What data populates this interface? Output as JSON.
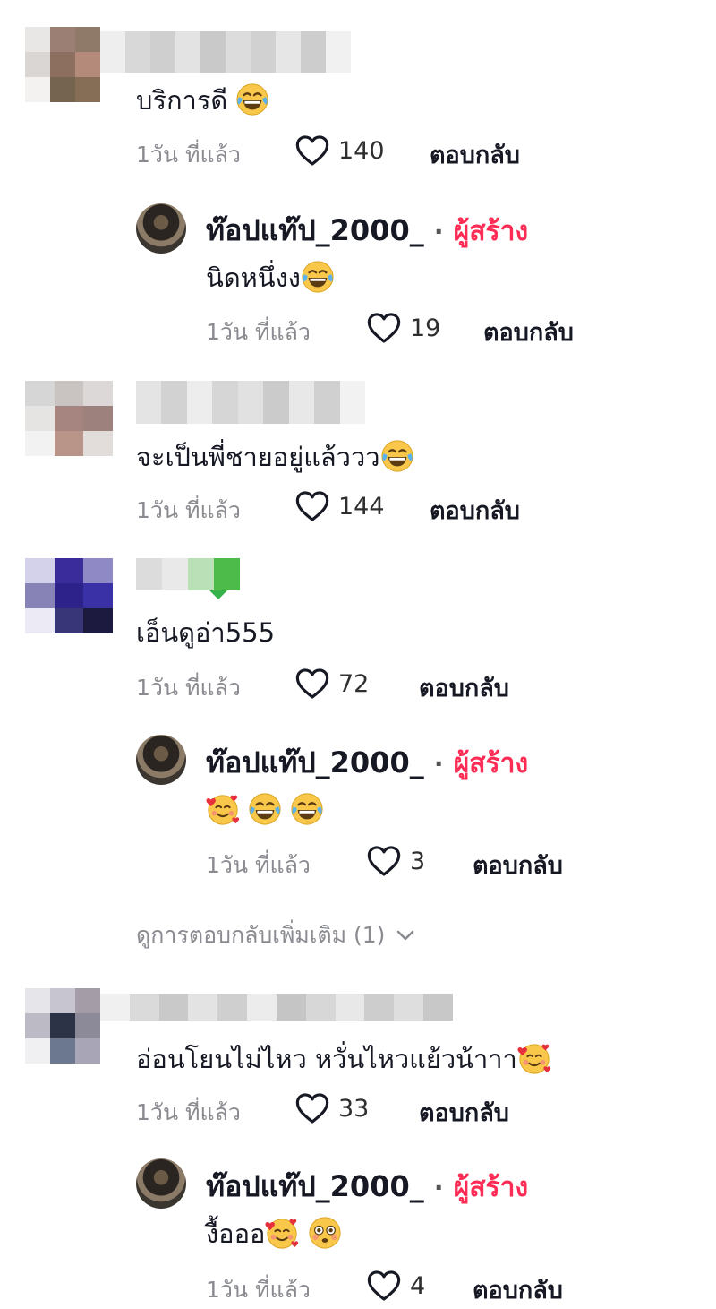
{
  "comments": [
    {
      "text": "บริการดี",
      "emojis": [
        "laugh-cry-emoji"
      ],
      "time": "1วัน ที่แล้ว",
      "likes": "140",
      "reply": "ตอบกลับ",
      "replies": [
        {
          "name": "ท๊อปแท๊ป_2000_",
          "badge": "ผู้สร้าง",
          "text": "นิดหนึ่งง",
          "emojis": [
            "laugh-cry-emoji"
          ],
          "time": "1วัน ที่แล้ว",
          "likes": "19",
          "reply": "ตอบกลับ"
        }
      ]
    },
    {
      "text": "จะเป็นพี่ชายอยู่แล้ววว",
      "emojis": [
        "laugh-cry-emoji"
      ],
      "time": "1วัน ที่แล้ว",
      "likes": "144",
      "reply": "ตอบกลับ",
      "replies": []
    },
    {
      "text": "เอ็นดูอ่า555",
      "emojis": [],
      "time": "1วัน ที่แล้ว",
      "likes": "72",
      "reply": "ตอบกลับ",
      "replies": [
        {
          "name": "ท๊อปแท๊ป_2000_",
          "badge": "ผู้สร้าง",
          "text": "",
          "emojis": [
            "hearts-face-emoji",
            "laugh-cry-emoji",
            "laugh-cry-emoji"
          ],
          "time": "1วัน ที่แล้ว",
          "likes": "3",
          "reply": "ตอบกลับ"
        }
      ],
      "more_replies": "ดูการตอบกลับเพิ่มเติม (1)"
    },
    {
      "text": "อ่อนโยนไม่ไหว หวั่นไหวแย้วน้าาา",
      "emojis": [
        "hearts-face-emoji"
      ],
      "time": "1วัน ที่แล้ว",
      "likes": "33",
      "reply": "ตอบกลับ",
      "replies": [
        {
          "name": "ท๊อปแท๊ป_2000_",
          "badge": "ผู้สร้าง",
          "text": "งื้อออ",
          "emojis": [
            "hearts-face-emoji",
            "flushed-face-emoji"
          ],
          "time": "1วัน ที่แล้ว",
          "likes": "4",
          "reply": "ตอบกลับ"
        }
      ]
    }
  ],
  "colors": {
    "creator_badge": "#fe2c55",
    "meta_text": "#8a8b91",
    "primary_text": "#161823"
  }
}
